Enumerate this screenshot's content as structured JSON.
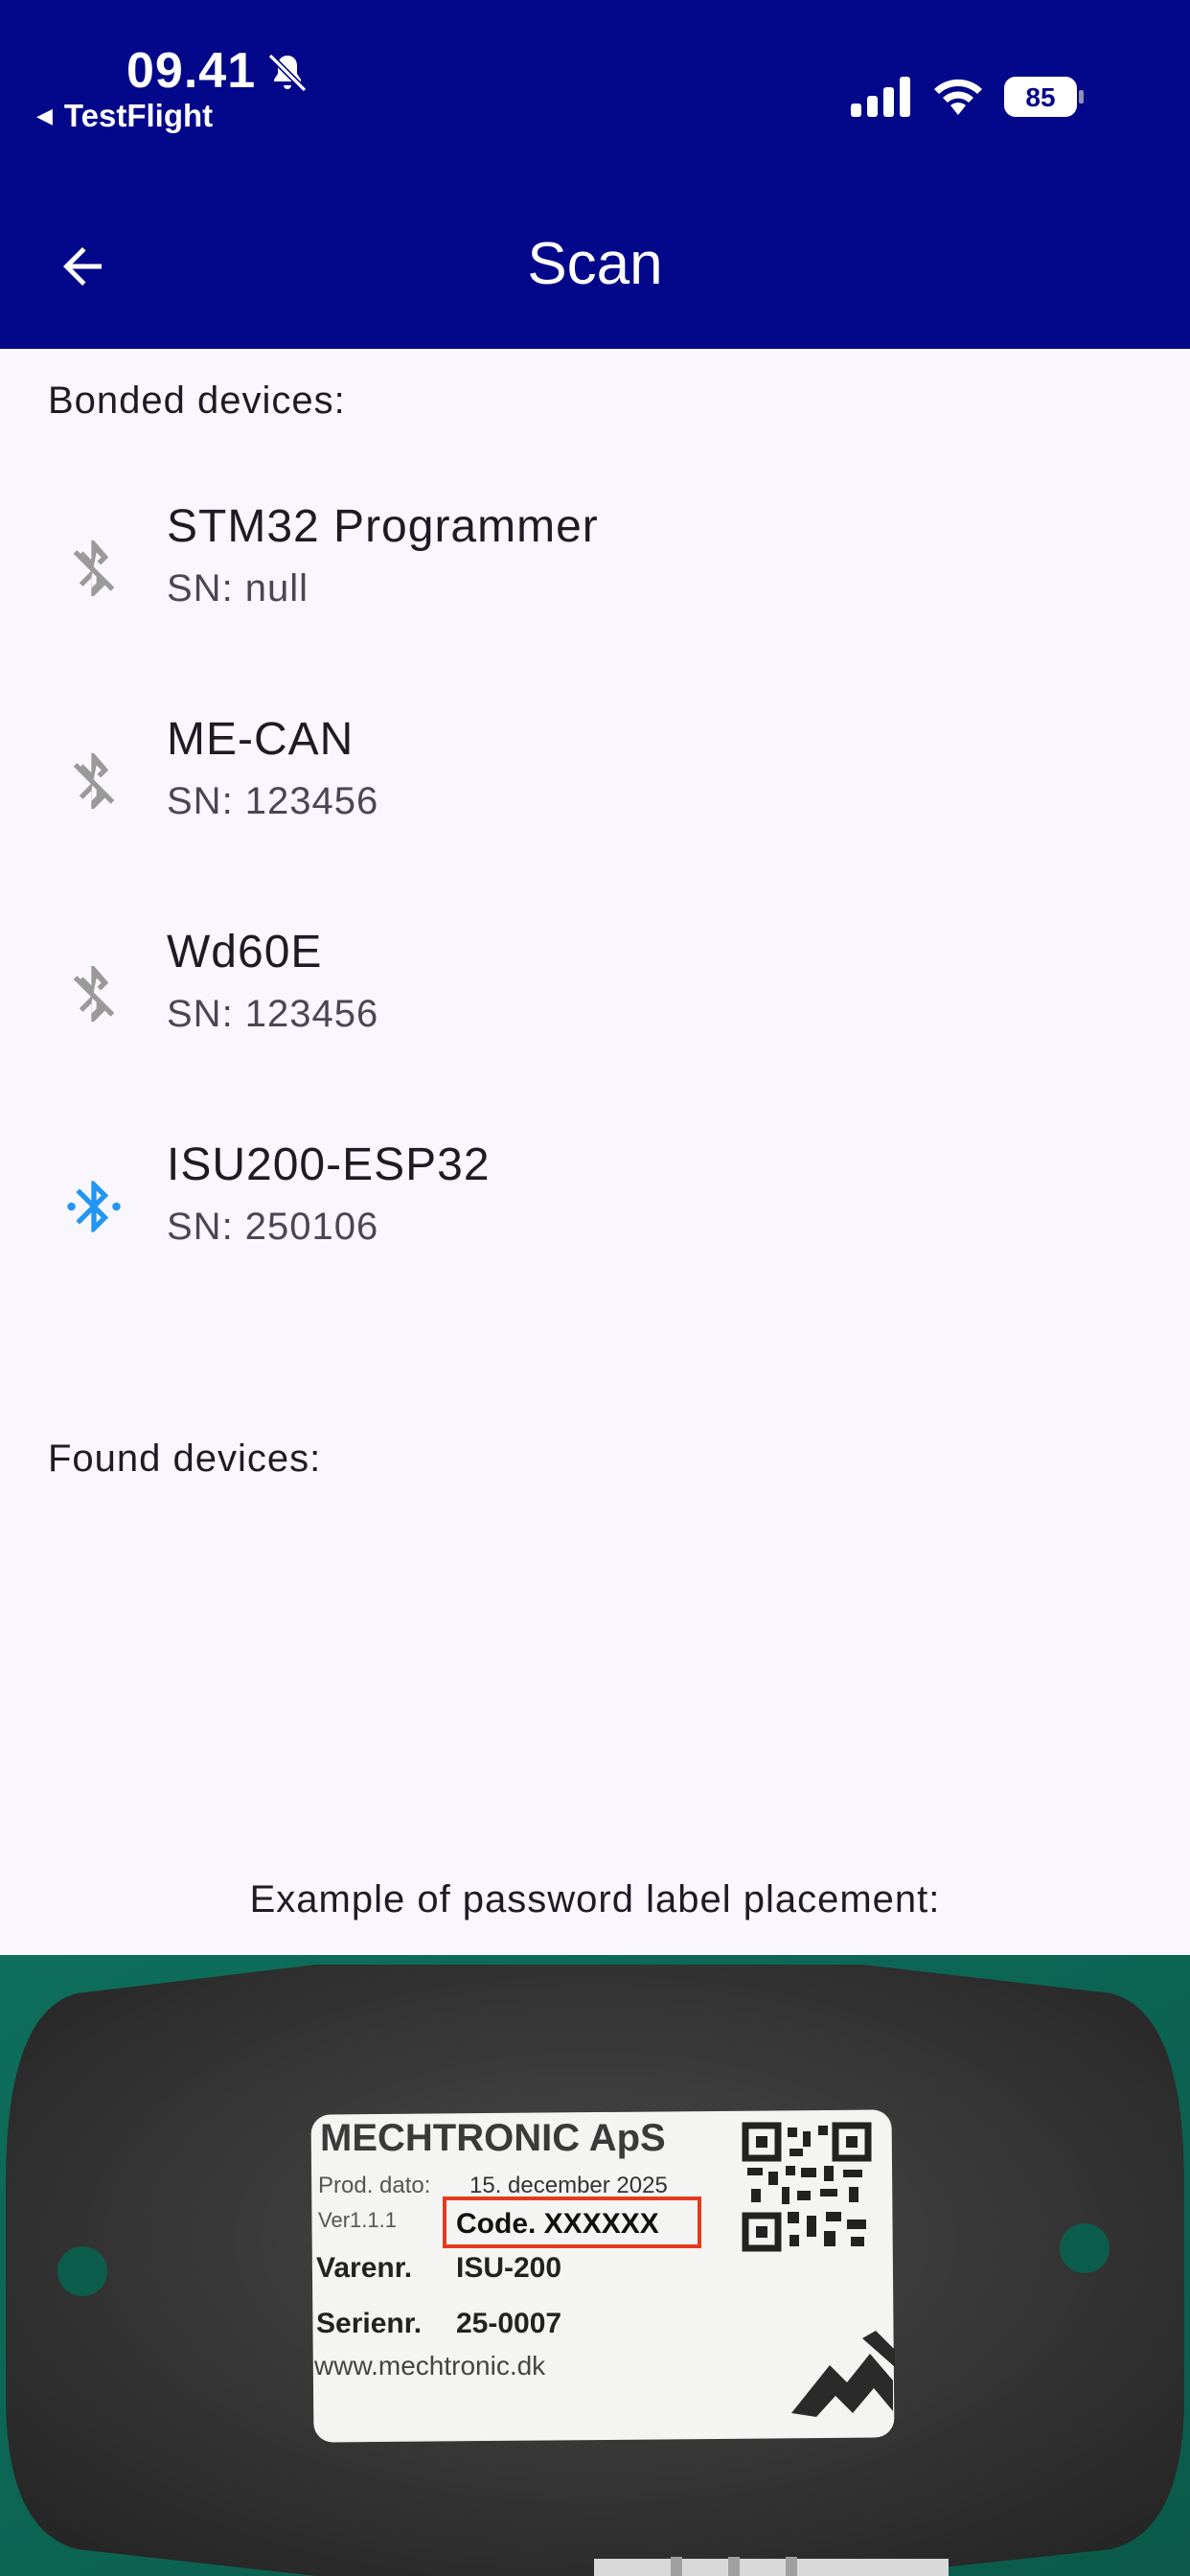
{
  "status_bar": {
    "time": "09.41",
    "back_app": "TestFlight",
    "battery": "85"
  },
  "app_bar": {
    "title": "Scan",
    "back_icon": "arrow-left-icon"
  },
  "bonded": {
    "label": "Bonded devices:",
    "items": [
      {
        "name": "STM32 Programmer",
        "sn": "SN: null",
        "icon": "bluetooth-disabled-icon",
        "color": "#9a9a9a"
      },
      {
        "name": "ME-CAN",
        "sn": "SN: 123456",
        "icon": "bluetooth-disabled-icon",
        "color": "#9a9a9a"
      },
      {
        "name": "Wd60E",
        "sn": "SN: 123456",
        "icon": "bluetooth-disabled-icon",
        "color": "#9a9a9a"
      },
      {
        "name": "ISU200-ESP32",
        "sn": "SN: 250106",
        "icon": "bluetooth-connected-icon",
        "color": "#2196f3"
      }
    ]
  },
  "found": {
    "label": "Found devices:"
  },
  "example": {
    "caption": "Example of password label placement:",
    "label": {
      "company": "MECHTRONIC ApS",
      "prod_date_label": "Prod. dato:",
      "prod_date": "15. december 2025",
      "version": "Ver1.1.1",
      "code": "Code. XXXXXX",
      "varenr_label": "Varenr.",
      "varenr": "ISU-200",
      "serienr_label": "Serienr.",
      "serienr": "25-0007",
      "website": "www.mechtronic.dk"
    }
  },
  "colors": {
    "header_bg": "#03078a",
    "page_bg": "#f9f7fd",
    "bt_active": "#2196f3",
    "bt_inactive": "#9a9a9a",
    "code_highlight": "#e53a1e"
  }
}
